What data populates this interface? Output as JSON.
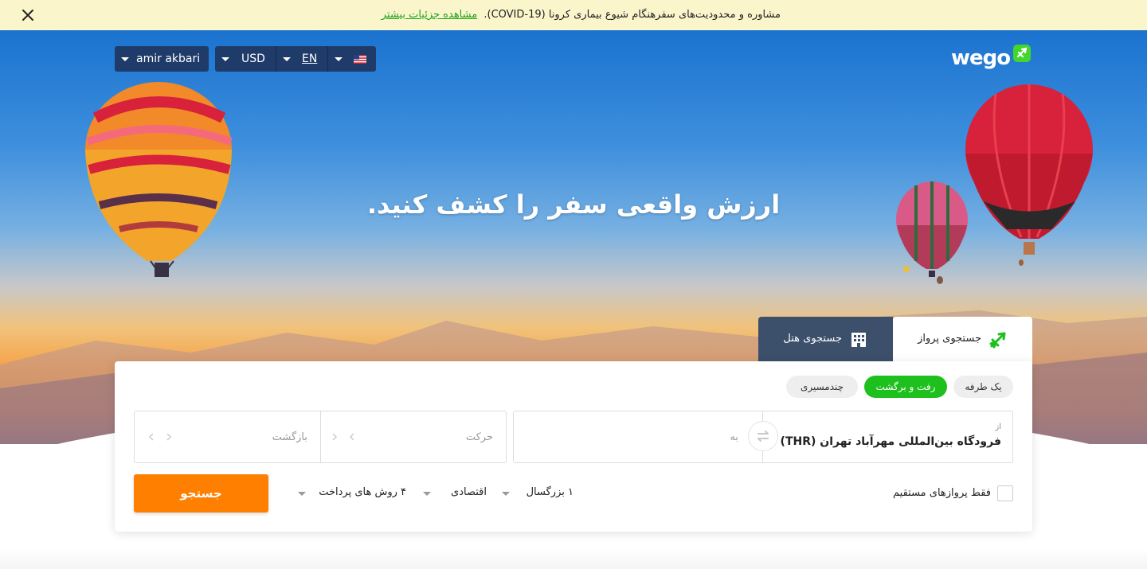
{
  "notice": {
    "text": "مشاوره و محدودیت‌های سفرهنگام شیوع بیماری کرونا (COVID-19).",
    "link": "مشاهده جزئیات بیشتر",
    "close_icon": "close-icon"
  },
  "header": {
    "logo_text": "wego",
    "user": "amir akbari",
    "currency": "USD",
    "language": "EN",
    "flag_icon": "us-flag-icon"
  },
  "hero": {
    "title": "ارزش واقعی سفر را کشف کنید."
  },
  "tabs": {
    "flight": "جستجوی پرواز",
    "hotel": "جستجوی هتل"
  },
  "trip_types": {
    "one_way": "یک طرفه",
    "round_trip": "رفت و برگشت",
    "multi_city": "چندمسیری"
  },
  "route": {
    "from_label": "از",
    "from_value": "فرودگاه بین‌المللی مهرآباد تهران (THR)",
    "to_placeholder": "به"
  },
  "dates": {
    "depart": "حرکت",
    "return": "بازگشت"
  },
  "options": {
    "direct_only": "فقط پروازهای مستقیم",
    "passengers": "۱ بزرگسال",
    "cabin": "اقتصادی",
    "payment": "۴ روش های پرداخت"
  },
  "search_button": "جستجو",
  "colors": {
    "accent_green": "#1dc01d",
    "search_orange": "#ff7f00",
    "control_navy": "#1f3b6a",
    "hotel_tab": "#3c4f6b",
    "notice_bg": "#fbf5cc"
  }
}
